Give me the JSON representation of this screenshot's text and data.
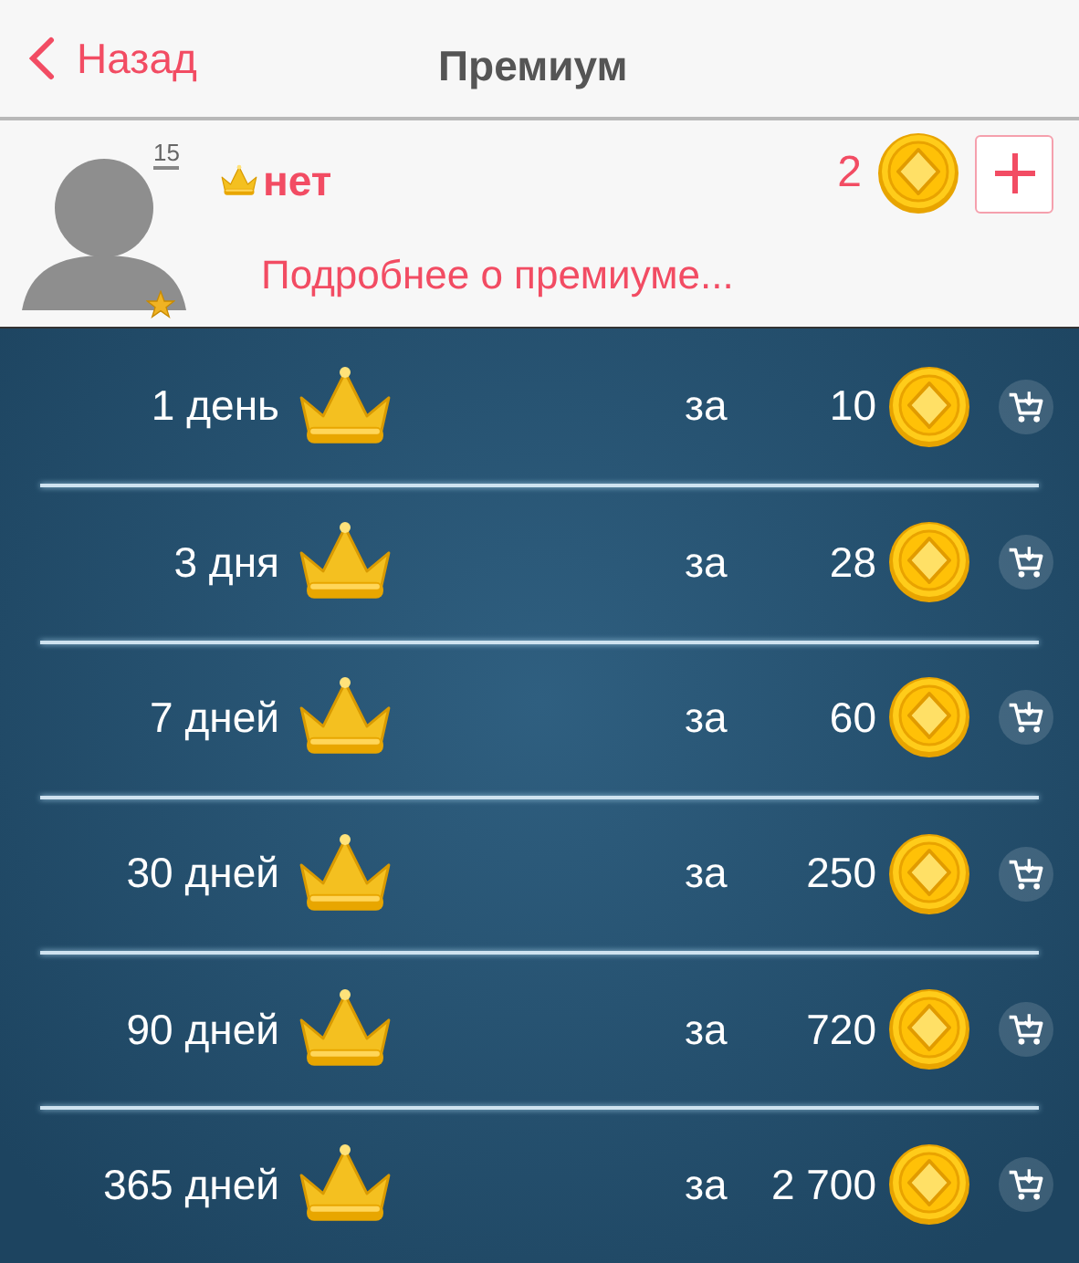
{
  "header": {
    "back_label": "Назад",
    "title": "Премиум"
  },
  "profile": {
    "level_badge": "15",
    "premium_status": "нет",
    "coins": "2",
    "more_link": "Подробнее о премиуме..."
  },
  "plans": [
    {
      "duration": "1 день",
      "price_prefix": "за",
      "price": "10"
    },
    {
      "duration": "3 дня",
      "price_prefix": "за",
      "price": "28"
    },
    {
      "duration": "7 дней",
      "price_prefix": "за",
      "price": "60"
    },
    {
      "duration": "30 дней",
      "price_prefix": "за",
      "price": "250"
    },
    {
      "duration": "90 дней",
      "price_prefix": "за",
      "price": "720"
    },
    {
      "duration": "365 дней",
      "price_prefix": "за",
      "price": "2 700"
    }
  ]
}
